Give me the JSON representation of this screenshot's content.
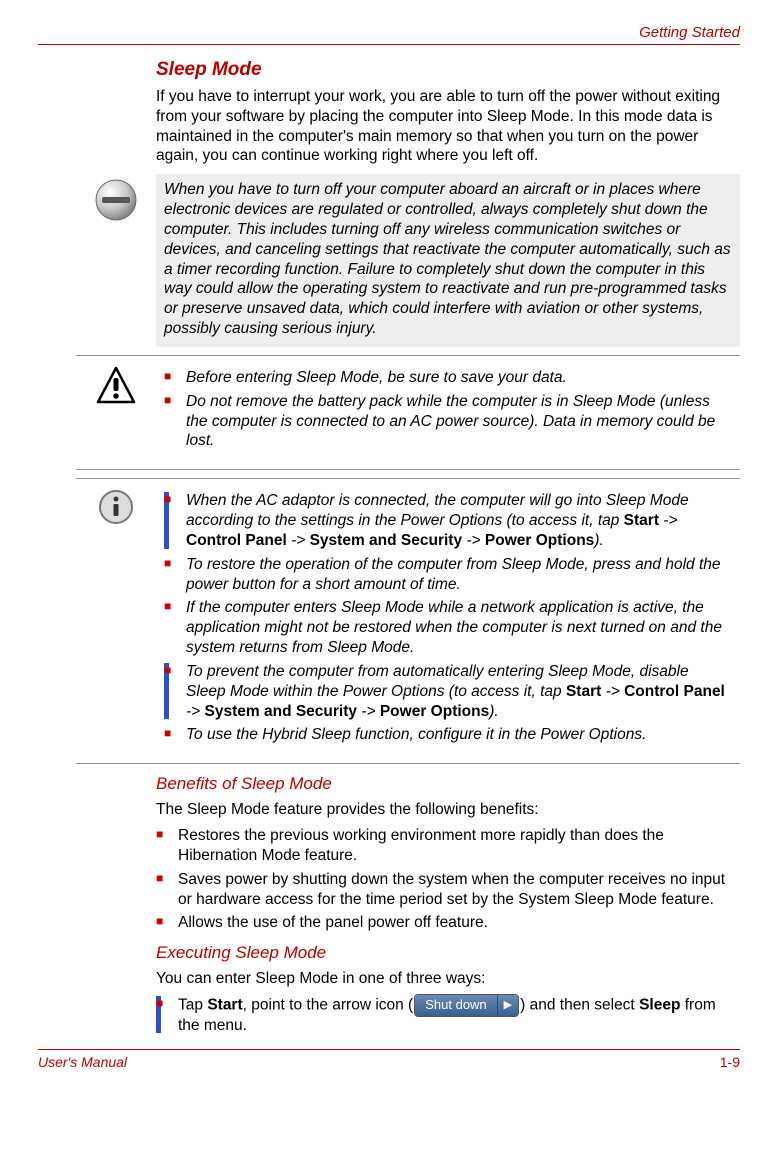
{
  "header": {
    "section": "Getting Started"
  },
  "footer": {
    "left": "User's Manual",
    "right": "1-9"
  },
  "sleep_mode": {
    "title": "Sleep Mode",
    "intro": "If you have to interrupt your work, you are able to turn off the power without exiting from your software by placing the computer into Sleep Mode. In this mode data is maintained in the computer's main memory so that when you turn on the power again, you can continue working right where you left off.",
    "note_aircraft": "When you have to turn off your computer aboard an aircraft or in places where electronic devices are regulated or controlled, always completely shut down the computer. This includes turning off any wireless communication switches or devices, and canceling settings that reactivate the computer automatically, such as a timer recording function. Failure to completely shut down the computer in this way could allow the operating system to reactivate and run pre-programmed tasks or preserve unsaved data, which could interfere with aviation or other systems, possibly causing serious injury.",
    "caution": {
      "item1": "Before entering Sleep Mode, be sure to save your data.",
      "item2": "Do not remove the battery pack while the computer is in Sleep Mode (unless the computer is connected to an AC power source). Data in memory could be lost."
    },
    "info": {
      "item1_pre": "When the AC adaptor is connected, the computer will go into Sleep Mode according to the settings in the Power Options (to access it, tap ",
      "start": "Start",
      "arrow1": " -> ",
      "cp": "Control Panel",
      "arrow2": " -> ",
      "ss": "System and Security",
      "arrow3": " -> ",
      "po": "Power Options",
      "item1_post": ").",
      "item2": "To restore the operation of the computer from Sleep Mode, press and hold the power button for a short amount of time.",
      "item3": "If the computer enters Sleep Mode while a network application is active, the application might not be restored when the computer is next turned on and the system returns from Sleep Mode.",
      "item4_pre": "To prevent the computer from automatically entering Sleep Mode, disable Sleep Mode within the Power Options (to access it, tap ",
      "item4_post": ").",
      "item5": "To use the Hybrid Sleep function, configure it in the Power Options."
    }
  },
  "benefits": {
    "title": "Benefits of Sleep Mode",
    "intro": "The Sleep Mode feature provides the following benefits:",
    "item1": "Restores the previous working environment more rapidly than does the Hibernation Mode feature.",
    "item2": "Saves power by shutting down the system when the computer receives no input or hardware access for the time period set by the System Sleep Mode feature.",
    "item3": "Allows the use of the panel power off feature."
  },
  "executing": {
    "title": "Executing Sleep Mode",
    "intro": "You can enter Sleep Mode in one of three ways:",
    "item1_pre": "Tap ",
    "item1_start": "Start",
    "item1_mid1": ", point to the arrow icon (",
    "shutdown_label": "Shut down",
    "item1_mid2": ") and then select ",
    "item1_sleep": "Sleep",
    "item1_post": " from the menu."
  }
}
